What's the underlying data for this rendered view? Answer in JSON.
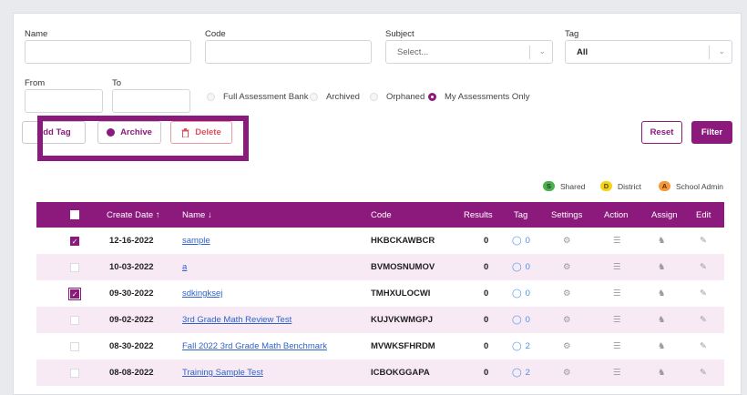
{
  "filters": {
    "name_label": "Name",
    "code_label": "Code",
    "subject_label": "Subject",
    "subject_value": "Select...",
    "tag_label": "Tag",
    "tag_value": "All",
    "from_label": "From",
    "to_label": "To",
    "radios": [
      {
        "label": "Full Assessment Bank",
        "selected": false
      },
      {
        "label": "Archived",
        "selected": false
      },
      {
        "label": "Orphaned",
        "selected": false
      },
      {
        "label": "My Assessments Only",
        "selected": true
      }
    ]
  },
  "actions": {
    "add_tag": "Add Tag",
    "archive": "Archive",
    "delete": "Delete",
    "reset": "Reset",
    "filter": "Filter"
  },
  "legend": {
    "shared_badge": "S",
    "shared": "Shared",
    "district_badge": "D",
    "district": "District",
    "school_admin_badge": "A",
    "school_admin": "School Admin"
  },
  "colors": {
    "accent": "#8b1a7c",
    "shared": "#4caf50",
    "district": "#f5d31a",
    "school_admin": "#f59a3b",
    "row_alt": "#f7eaf5"
  },
  "table": {
    "headers": {
      "create_date": "Create Date ↑",
      "name": "Name ↓",
      "code": "Code",
      "results": "Results",
      "tag": "Tag",
      "settings": "Settings",
      "action": "Action",
      "assign": "Assign",
      "edit": "Edit"
    },
    "rows": [
      {
        "checked": true,
        "date": "12-16-2022",
        "name": "sample",
        "code": "HKBCKAWBCR",
        "results": "0",
        "tag": "0"
      },
      {
        "checked": false,
        "date": "10-03-2022",
        "name": "a",
        "code": "BVMOSNUMOV",
        "results": "0",
        "tag": "0"
      },
      {
        "checked": true,
        "date": "09-30-2022",
        "name": "sdkingksej",
        "code": "TMHXULOCWI",
        "results": "0",
        "tag": "0"
      },
      {
        "checked": false,
        "date": "09-02-2022",
        "name": "3rd Grade Math Review Test",
        "code": "KUJVKWMGPJ",
        "results": "0",
        "tag": "0"
      },
      {
        "checked": false,
        "date": "08-30-2022",
        "name": "Fall 2022 3rd Grade Math Benchmark",
        "code": "MVWKSFHRDM",
        "results": "0",
        "tag": "2"
      },
      {
        "checked": false,
        "date": "08-08-2022",
        "name": "Training Sample Test",
        "code": "ICBOKGGAPA",
        "results": "0",
        "tag": "2"
      }
    ]
  }
}
